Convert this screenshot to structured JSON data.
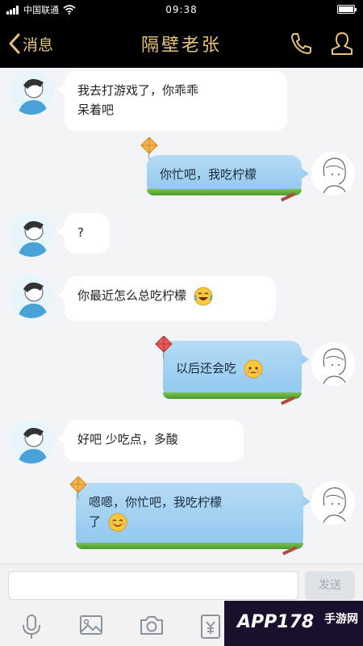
{
  "status_bar": {
    "signal_icon": "signal-icon",
    "carrier": "中国联通",
    "wifi_icon": "wifi-icon",
    "time": "09:38",
    "battery_level": 0.9
  },
  "nav_bar": {
    "back_label": "消息",
    "title": "隔壁老张",
    "call_icon": "phone-icon",
    "profile_icon": "person-icon"
  },
  "messages": [
    {
      "side": "in",
      "text_line1": "我去打游戏了，你乖乖",
      "text_line2": "呆着吧"
    },
    {
      "side": "out",
      "text": "你忙吧，我吃柠檬"
    },
    {
      "side": "in",
      "text": "?"
    },
    {
      "side": "in",
      "text": "你最近怎么总吃柠檬",
      "emoji": "laughing-tears-emoji"
    },
    {
      "side": "out",
      "text": "以后还会吃",
      "emoji": "pleading-face-emoji"
    },
    {
      "side": "in",
      "text": "好吧 少吃点，多酸"
    },
    {
      "side": "out",
      "text_line1": "嗯嗯，你忙吧，我吃柠檬",
      "text_line2": "了",
      "emoji": "smiling-face-emoji"
    }
  ],
  "input": {
    "value": "",
    "send_label": "发送"
  },
  "toolbar": {
    "items": [
      "mic-icon",
      "image-icon",
      "camera-icon",
      "red-packet-icon"
    ]
  },
  "watermark": {
    "text": "APP178",
    "sub": "手游网"
  }
}
